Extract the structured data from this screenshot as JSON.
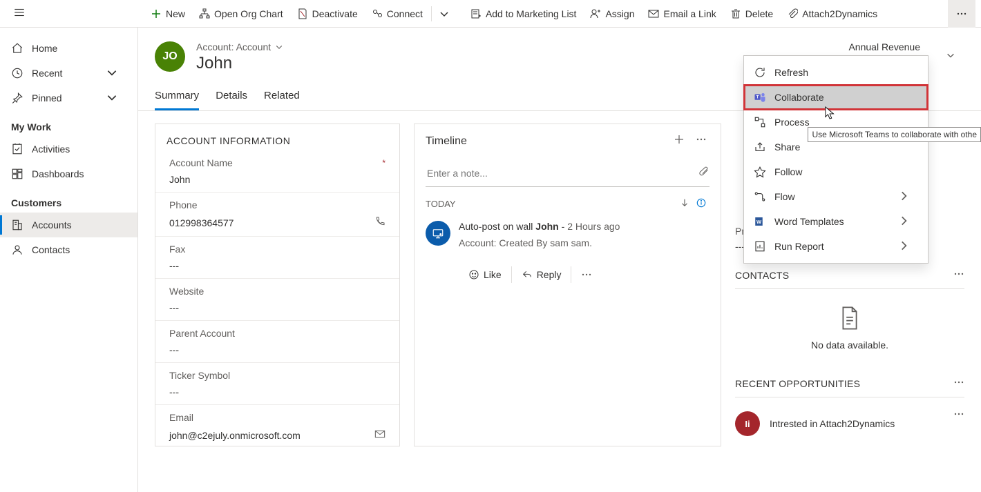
{
  "commands": {
    "new": "New",
    "openOrgChart": "Open Org Chart",
    "deactivate": "Deactivate",
    "connect": "Connect",
    "addMarketing": "Add to Marketing List",
    "assign": "Assign",
    "emailLink": "Email a Link",
    "delete": "Delete",
    "attach2dyn": "Attach2Dynamics"
  },
  "nav": {
    "home": "Home",
    "recent": "Recent",
    "pinned": "Pinned",
    "groups": {
      "myWork": "My Work",
      "customers": "Customers"
    },
    "activities": "Activities",
    "dashboards": "Dashboards",
    "accounts": "Accounts",
    "contacts": "Contacts"
  },
  "record": {
    "avatarInitials": "JO",
    "breadcrumb": "Account: Account",
    "title": "John",
    "headerField": {
      "label": "Annual Revenue",
      "value": "---"
    }
  },
  "tabs": [
    "Summary",
    "Details",
    "Related"
  ],
  "activeTab": 0,
  "accountInfo": {
    "sectionTitle": "ACCOUNT INFORMATION",
    "fields": [
      {
        "label": "Account Name",
        "value": "John",
        "required": true
      },
      {
        "label": "Phone",
        "value": "012998364577",
        "rightIcon": "phone"
      },
      {
        "label": "Fax",
        "value": "---"
      },
      {
        "label": "Website",
        "value": "---"
      },
      {
        "label": "Parent Account",
        "value": "---"
      },
      {
        "label": "Ticker Symbol",
        "value": "---"
      },
      {
        "label": "Email",
        "value": "john@c2ejuly.onmicrosoft.com",
        "rightIcon": "mail"
      }
    ]
  },
  "timeline": {
    "title": "Timeline",
    "notePlaceholder": "Enter a note...",
    "todayLabel": "TODAY",
    "post": {
      "prefix": "Auto-post on wall ",
      "boldName": "John",
      "sep": " -   ",
      "time": "2 Hours ago",
      "body": "Account: Created By sam sam."
    },
    "actions": {
      "like": "Like",
      "reply": "Reply"
    }
  },
  "rightCol": {
    "primaryContact": {
      "label": "Primary Contact",
      "value": "---"
    },
    "contactsTitle": "CONTACTS",
    "emptyText": "No data available.",
    "recentOppsTitle": "RECENT OPPORTUNITIES",
    "opportunity": {
      "initials": "Ii",
      "name": "Intrested in Attach2Dynamics"
    }
  },
  "overflow": {
    "refresh": "Refresh",
    "collaborate": "Collaborate",
    "process": "Process",
    "share": "Share",
    "follow": "Follow",
    "flow": "Flow",
    "wordTemplates": "Word Templates",
    "runReport": "Run Report",
    "tooltip": "Use Microsoft Teams to collaborate with othe"
  }
}
